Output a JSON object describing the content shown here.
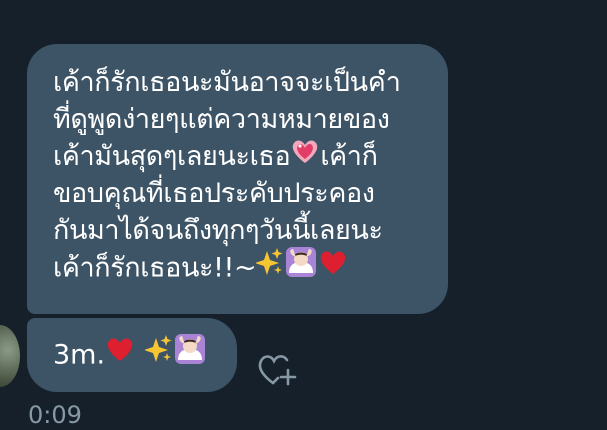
{
  "message": {
    "lines": [
      "เค้าก็รักเธอนะมันอาจจะเป็นคำ",
      "ที่ดูพูดง่ายๆแต่ความหมายของ",
      "เค้ามันสุดๆเลยนะเธอ",
      "เค้าก็",
      "ขอบคุณที่เธอประคับประคอง",
      "กันมาได้จนถึงทุกๆวันนี้เลยนะ",
      "เค้าก็รักเธอนะ!!~"
    ],
    "icons": [
      "sparkling-heart-icon",
      "sparkles-icon",
      "heart-hands-woman-icon",
      "red-heart-icon"
    ]
  },
  "reply": {
    "text": "3m.",
    "icons": [
      "red-heart-icon",
      "sparkles-icon",
      "heart-hands-woman-icon"
    ]
  },
  "timestamp": "0:09",
  "actions": {
    "react_icon": "add-reaction-heart-icon"
  },
  "colors": {
    "background": "#15202b",
    "bubble": "#3d5466",
    "text": "#ffffff",
    "timestamp": "#8899a6",
    "heart": "#dd1f30"
  }
}
